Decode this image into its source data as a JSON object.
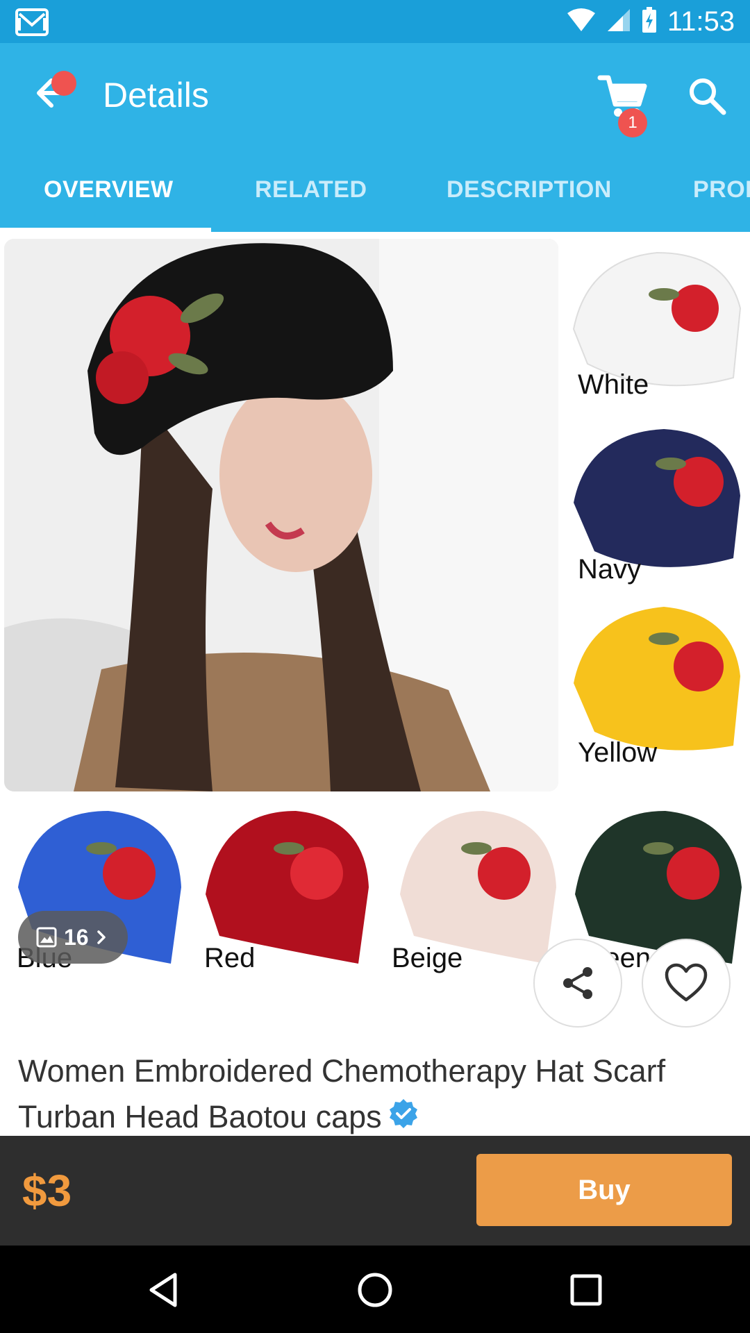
{
  "status_bar": {
    "time": "11:53"
  },
  "app_bar": {
    "title": "Details",
    "cart_count": "1"
  },
  "tabs": [
    {
      "label": "OVERVIEW",
      "active": true
    },
    {
      "label": "RELATED",
      "active": false
    },
    {
      "label": "DESCRIPTION",
      "active": false
    },
    {
      "label": "PROD",
      "active": false
    }
  ],
  "gallery": {
    "count": "16",
    "side_variants": [
      {
        "label": "White",
        "color": "#f4f4f4"
      },
      {
        "label": "Navy",
        "color": "#232a5c"
      },
      {
        "label": "Yellow",
        "color": "#f7c21c"
      }
    ],
    "bottom_variants": [
      {
        "label": "Blue",
        "color": "#2f5fd4"
      },
      {
        "label": "Red",
        "color": "#b1101e"
      },
      {
        "label": "Beige",
        "color": "#f0ddd6"
      },
      {
        "label": "Green",
        "color": "#1f3529"
      }
    ]
  },
  "product": {
    "title": "Women Embroidered Chemotherapy Hat Scarf Turban Head Baotou caps",
    "price": "$3",
    "buy_label": "Buy"
  },
  "colors": {
    "status_bar": "#1a9fd9",
    "app_bar": "#2fb3e6",
    "accent": "#ec9c48",
    "badge": "#ef5350"
  }
}
